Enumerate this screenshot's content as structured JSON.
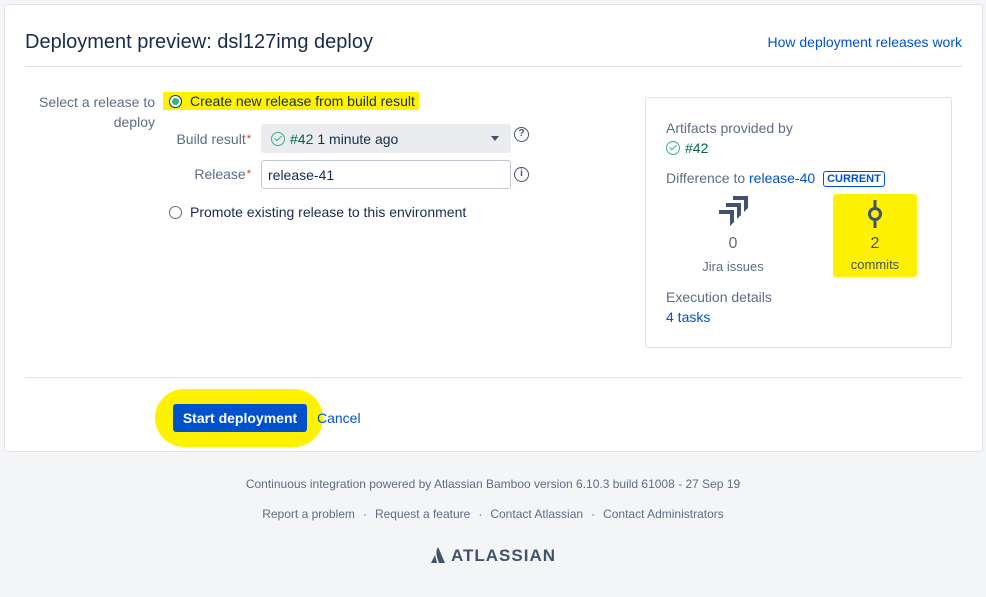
{
  "header": {
    "title": "Deployment preview: dsl127img deploy",
    "help_link": "How deployment releases work"
  },
  "form": {
    "select_release_label": "Select a release to deploy",
    "option_create": "Create new release from build result",
    "build_result_label": "Build result",
    "build_result_value": "#42",
    "build_result_time": "1 minute ago",
    "release_label": "Release",
    "release_value": "release-41",
    "option_promote": "Promote existing release to this environment"
  },
  "summary": {
    "artifacts_label": "Artifacts provided by",
    "artifacts_build": "#42",
    "difference_label": "Difference to",
    "difference_release": "release-40",
    "current_badge": "CURRENT",
    "jira_count": "0",
    "jira_label": "Jira issues",
    "commits_count": "2",
    "commits_label": "commits",
    "execution_label": "Execution details",
    "execution_tasks": "4 tasks"
  },
  "actions": {
    "start_label": "Start deployment",
    "cancel_label": "Cancel"
  },
  "footer": {
    "powered_by": "Continuous integration powered by Atlassian Bamboo version 6.10.3 build 61008 - 27 Sep 19",
    "links": [
      "Report a problem",
      "Request a feature",
      "Contact Atlassian",
      "Contact Administrators"
    ],
    "brand": "ATLASSIAN"
  },
  "colors": {
    "primary": "#0052cc",
    "success": "#36b37e",
    "highlight": "#fff200"
  }
}
